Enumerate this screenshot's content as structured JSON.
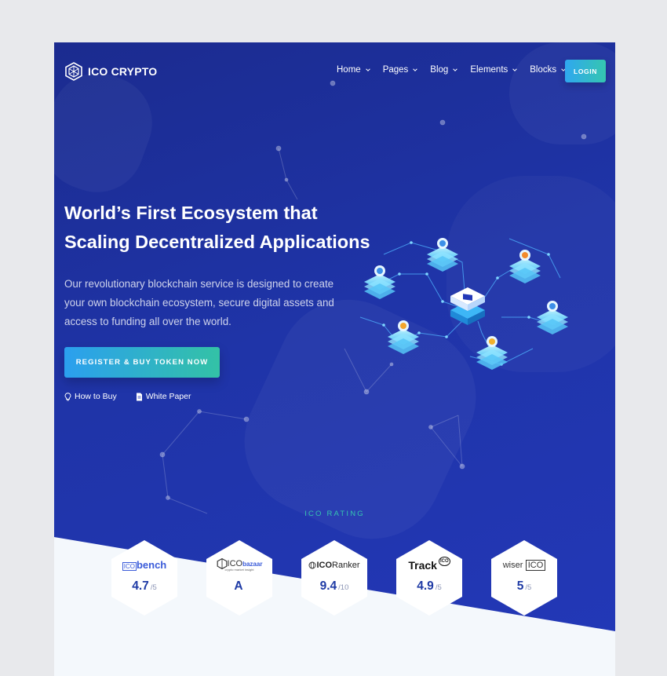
{
  "brand": {
    "name": "ICO CRYPTO"
  },
  "nav": {
    "items": [
      {
        "label": "Home"
      },
      {
        "label": "Pages"
      },
      {
        "label": "Blog"
      },
      {
        "label": "Elements"
      },
      {
        "label": "Blocks"
      }
    ],
    "login_label": "LOGIN"
  },
  "hero": {
    "title_line1": "World’s First Ecosystem that",
    "title_line2": "Scaling Decentralized Applications",
    "desc_line1": "Our revolutionary blockchain service is designed to create",
    "desc_line2": "your own blockchain ecosystem, secure digital assets and",
    "desc_line3": "access to funding all over the world.",
    "cta_label": "REGISTER & BUY TOKEN NOW",
    "how_to_buy": "How to Buy",
    "white_paper": "White Paper"
  },
  "ratings": {
    "label": "ICO RATING",
    "items": [
      {
        "logo_a": "ICO",
        "logo_b": "bench",
        "score": "4.7",
        "scale": "/5"
      },
      {
        "logo_a": "ICO",
        "logo_b": "bazaar",
        "tagline": "crypto market insight",
        "score": "A",
        "scale": ""
      },
      {
        "logo_a": "ICO",
        "logo_b": "Ranker",
        "score": "9.4",
        "scale": "/10"
      },
      {
        "logo_a": "Track",
        "logo_b": "ICO",
        "score": "4.9",
        "scale": "/5"
      },
      {
        "logo_a": "wiser",
        "logo_b": "ICO",
        "score": "5",
        "scale": "/5"
      }
    ]
  },
  "colors": {
    "bg_dark": "#1f34a8",
    "accent_teal": "#35c6b0",
    "accent_blue": "#2fa7f0",
    "score": "#1e3aa5"
  }
}
